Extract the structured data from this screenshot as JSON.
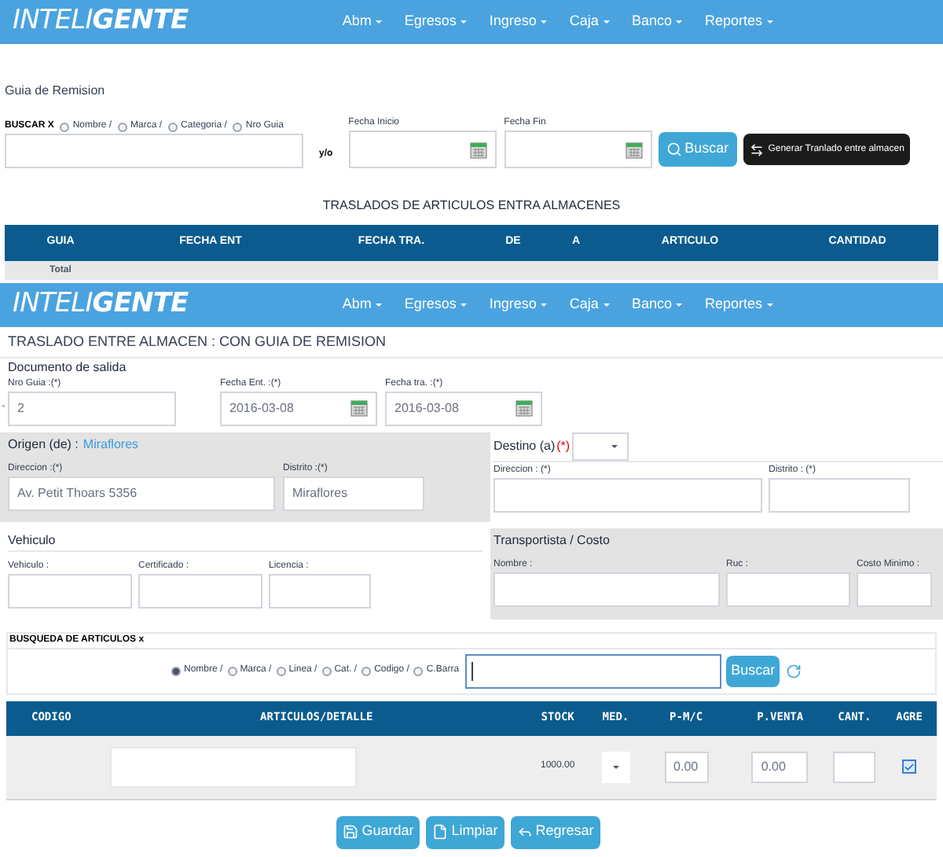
{
  "screen_1": {
    "brand": "INTELI**GENTE**",
    "menu": [
      "Abm",
      "Egresos",
      "Ingreso",
      "Caja",
      "Banco",
      "Reportes"
    ],
    "heading": "Guia de Remision",
    "search": {
      "label": "BUSCAR X",
      "joiner": "y/o",
      "options": [
        {
          "label": "Nombre /",
          "selected": false
        },
        {
          "label": "Marca /",
          "selected": false
        },
        {
          "label": "Categoria /",
          "selected": false
        },
        {
          "label": "Nro Guia",
          "selected": false
        }
      ]
    },
    "date_from": {
      "label": "Fecha Inicio"
    },
    "date_to": {
      "label": "Fecha Fin"
    },
    "search_button": "Buscar",
    "transfer_button": "Generar Tranlado entre almacen",
    "table": {
      "title": "TRASLADOS DE ARTICULOS ENTRA ALMACENES",
      "columns": [
        "GUIA",
        "FECHA ENT",
        "FECHA TRA.",
        "DE",
        "A",
        "ARTICULO",
        "CANTIDAD"
      ],
      "rows": [
        [
          "Total"
        ]
      ]
    }
  },
  "screen_2": {
    "brand": "INTELI**GENTE**",
    "menu": [
      "Abm",
      "Egresos",
      "Ingreso",
      "Caja",
      "Banco",
      "Reportes"
    ],
    "title": "TRASLADO ENTRE ALMACEN : CON GUIA DE REMISION",
    "documento": {
      "heading": "Documento de salida",
      "prefix": "-",
      "nro_guia": {
        "label": "Nro Guia :(*)",
        "value": "2"
      },
      "fecha_ent": {
        "label": "Fecha Ent. :(*)",
        "value": "2016-03-08"
      },
      "fecha_tra": {
        "label": "Fecha tra. :(*)",
        "value": "2016-03-08"
      }
    },
    "origen": {
      "heading": "Origen (de) :",
      "place": "Miraflores",
      "direccion": {
        "label": "Direccion :(*)",
        "value": "Av. Petit Thoars 5356"
      },
      "distrito": {
        "label": "Distrito :(*)",
        "value": "Miraflores"
      }
    },
    "destino": {
      "heading": "Destino (a)",
      "required": "(*)",
      "direccion": {
        "label": "Direccion : (*)"
      },
      "distrito": {
        "label": "Distrito : (*)"
      }
    },
    "vehiculo": {
      "heading": "Vehiculo",
      "fields": [
        "Vehiculo :",
        "Certificado :",
        "Licencia :"
      ]
    },
    "transportista": {
      "heading": "Transportista / Costo",
      "fields": [
        "Nombre :",
        "Ruc :",
        "Costo Minimo :"
      ]
    },
    "busqueda": {
      "heading": "BUSQUEDA DE ARTICULOS x",
      "options": [
        {
          "label": "Nombre /",
          "selected": true
        },
        {
          "label": "Marca /",
          "selected": false
        },
        {
          "label": "Linea /",
          "selected": false
        },
        {
          "label": "Cat. /",
          "selected": false
        },
        {
          "label": "Codigo /",
          "selected": false
        },
        {
          "label": "C.Barra",
          "selected": false
        }
      ],
      "button": "Buscar"
    },
    "table": {
      "columns": [
        "CODIGO",
        "ARTICULOS/DETALLE",
        "STOCK",
        "MED.",
        "P-M/C",
        "P.VENTA",
        "CANT.",
        "AGRE"
      ],
      "rows": [
        {
          "stock": "1000.00",
          "p_mc": "0.00",
          "p_venta": "0.00",
          "agre": true
        }
      ]
    },
    "buttons": [
      {
        "kind": "save",
        "label": "Guardar"
      },
      {
        "kind": "clear",
        "label": "Limpiar"
      },
      {
        "kind": "back",
        "label": "Regresar"
      }
    ]
  }
}
